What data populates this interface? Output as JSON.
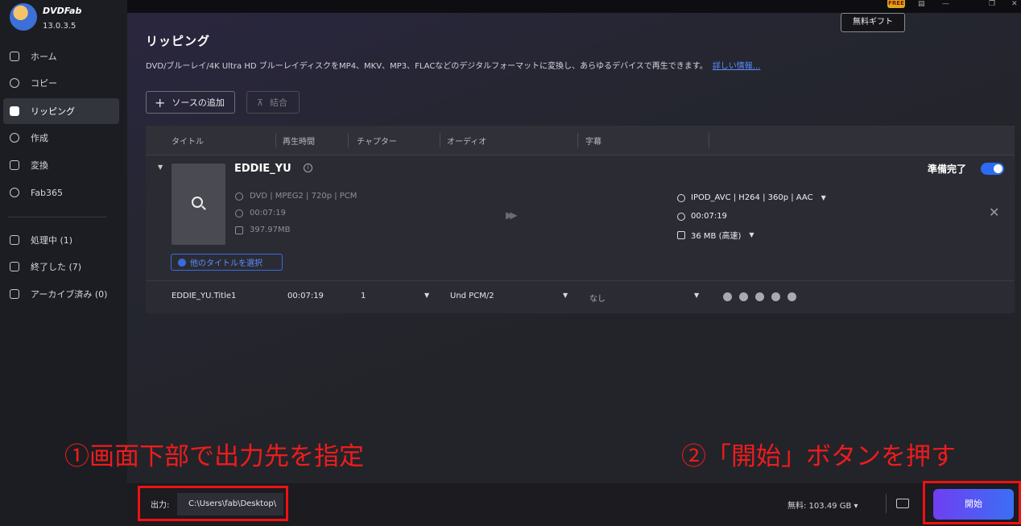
{
  "app": {
    "brand": "DVDFab",
    "version": "13.0.3.5"
  },
  "sidebar": {
    "items": [
      {
        "label": "ホーム"
      },
      {
        "label": "コピー"
      },
      {
        "label": "リッピング"
      },
      {
        "label": "作成"
      },
      {
        "label": "変換"
      },
      {
        "label": "Fab365"
      }
    ],
    "queue": [
      {
        "label": "処理中 (1)"
      },
      {
        "label": "終了した (7)"
      },
      {
        "label": "アーカイブ済み (0)"
      }
    ]
  },
  "topbar": {
    "badge": "FREE",
    "gift_label": "無料ギフト"
  },
  "page": {
    "title": "リッピング",
    "description": "DVD/ブルーレイ/4K Ultra HD ブルーレイディスクをMP4、MKV、MP3、FLACなどのデジタルフォーマットに変換し、あらゆるデバイスで再生できます。",
    "detail_link": "詳しい情報..."
  },
  "toolbar": {
    "add_source_label": "ソースの追加",
    "merge_label": "結合"
  },
  "table": {
    "headers": [
      "タイトル",
      "再生時間",
      "チャプター",
      "オーディオ",
      "字幕"
    ],
    "disc": {
      "title": "EDDIE_YU",
      "source_info": "DVD | MPEG2 | 720p | PCM",
      "duration": "00:07:19",
      "size": "397.97MB",
      "output_profile": "IPOD_AVC | H264 | 360p | AAC",
      "output_duration": "00:07:19",
      "output_size": "36 MB (高速)",
      "ready_label": "準備完了",
      "ready_on": true,
      "select_title_label": "他のタイトルを選択"
    },
    "row": {
      "title": "EDDIE_YU.Title1",
      "duration": "00:07:19",
      "chapter": "1",
      "audio": "Und  PCM/2",
      "subtitle": "なし"
    }
  },
  "annotations": {
    "left": "①画面下部で出力先を指定",
    "right": "②「開始」ボタンを押す"
  },
  "bottom": {
    "output_label": "出力:",
    "output_path": "C:\\Users\\fab\\Desktop\\",
    "free_space": "無料: 103.49 GB ▾",
    "start_label": "開始"
  },
  "colors": {
    "accent": "#2d6bf2",
    "annotation": "#ee1c1c",
    "start_from": "#6f3ef2",
    "start_to": "#3b6ff5"
  }
}
